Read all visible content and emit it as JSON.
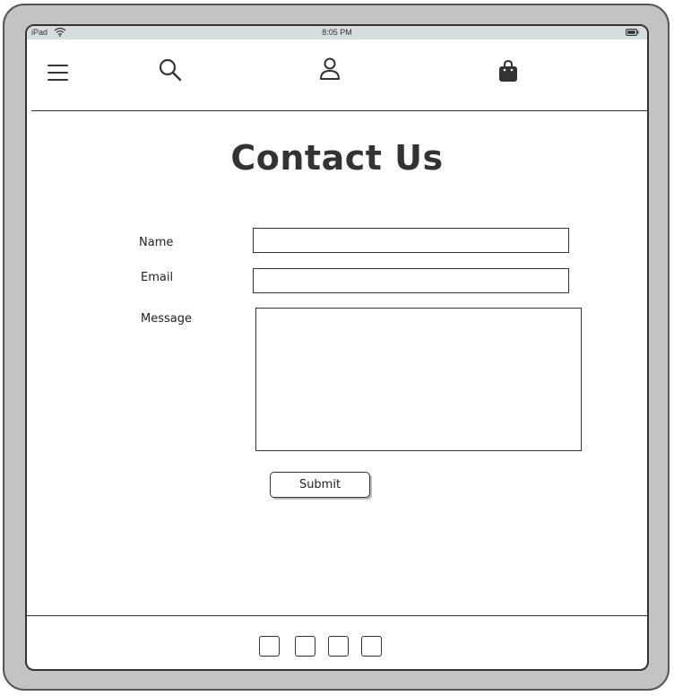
{
  "status_bar": {
    "device": "iPad",
    "time": "8:05 PM",
    "icons": [
      "wifi-icon",
      "battery-icon"
    ]
  },
  "nav": {
    "icons": [
      "menu-icon",
      "search-icon",
      "user-icon",
      "shopping-bag-icon"
    ]
  },
  "page": {
    "title": "Contact Us"
  },
  "form": {
    "name_label": "Name",
    "name_value": "",
    "email_label": "Email",
    "email_value": "",
    "message_label": "Message",
    "message_value": "",
    "submit_label": "Submit"
  },
  "footer": {
    "icons": [
      "footer-icon-1",
      "footer-icon-2",
      "footer-icon-3",
      "footer-icon-4"
    ]
  },
  "colors": {
    "frame": "#c3c3c3",
    "status_bar": "#d6dde0",
    "ink": "#333333"
  }
}
